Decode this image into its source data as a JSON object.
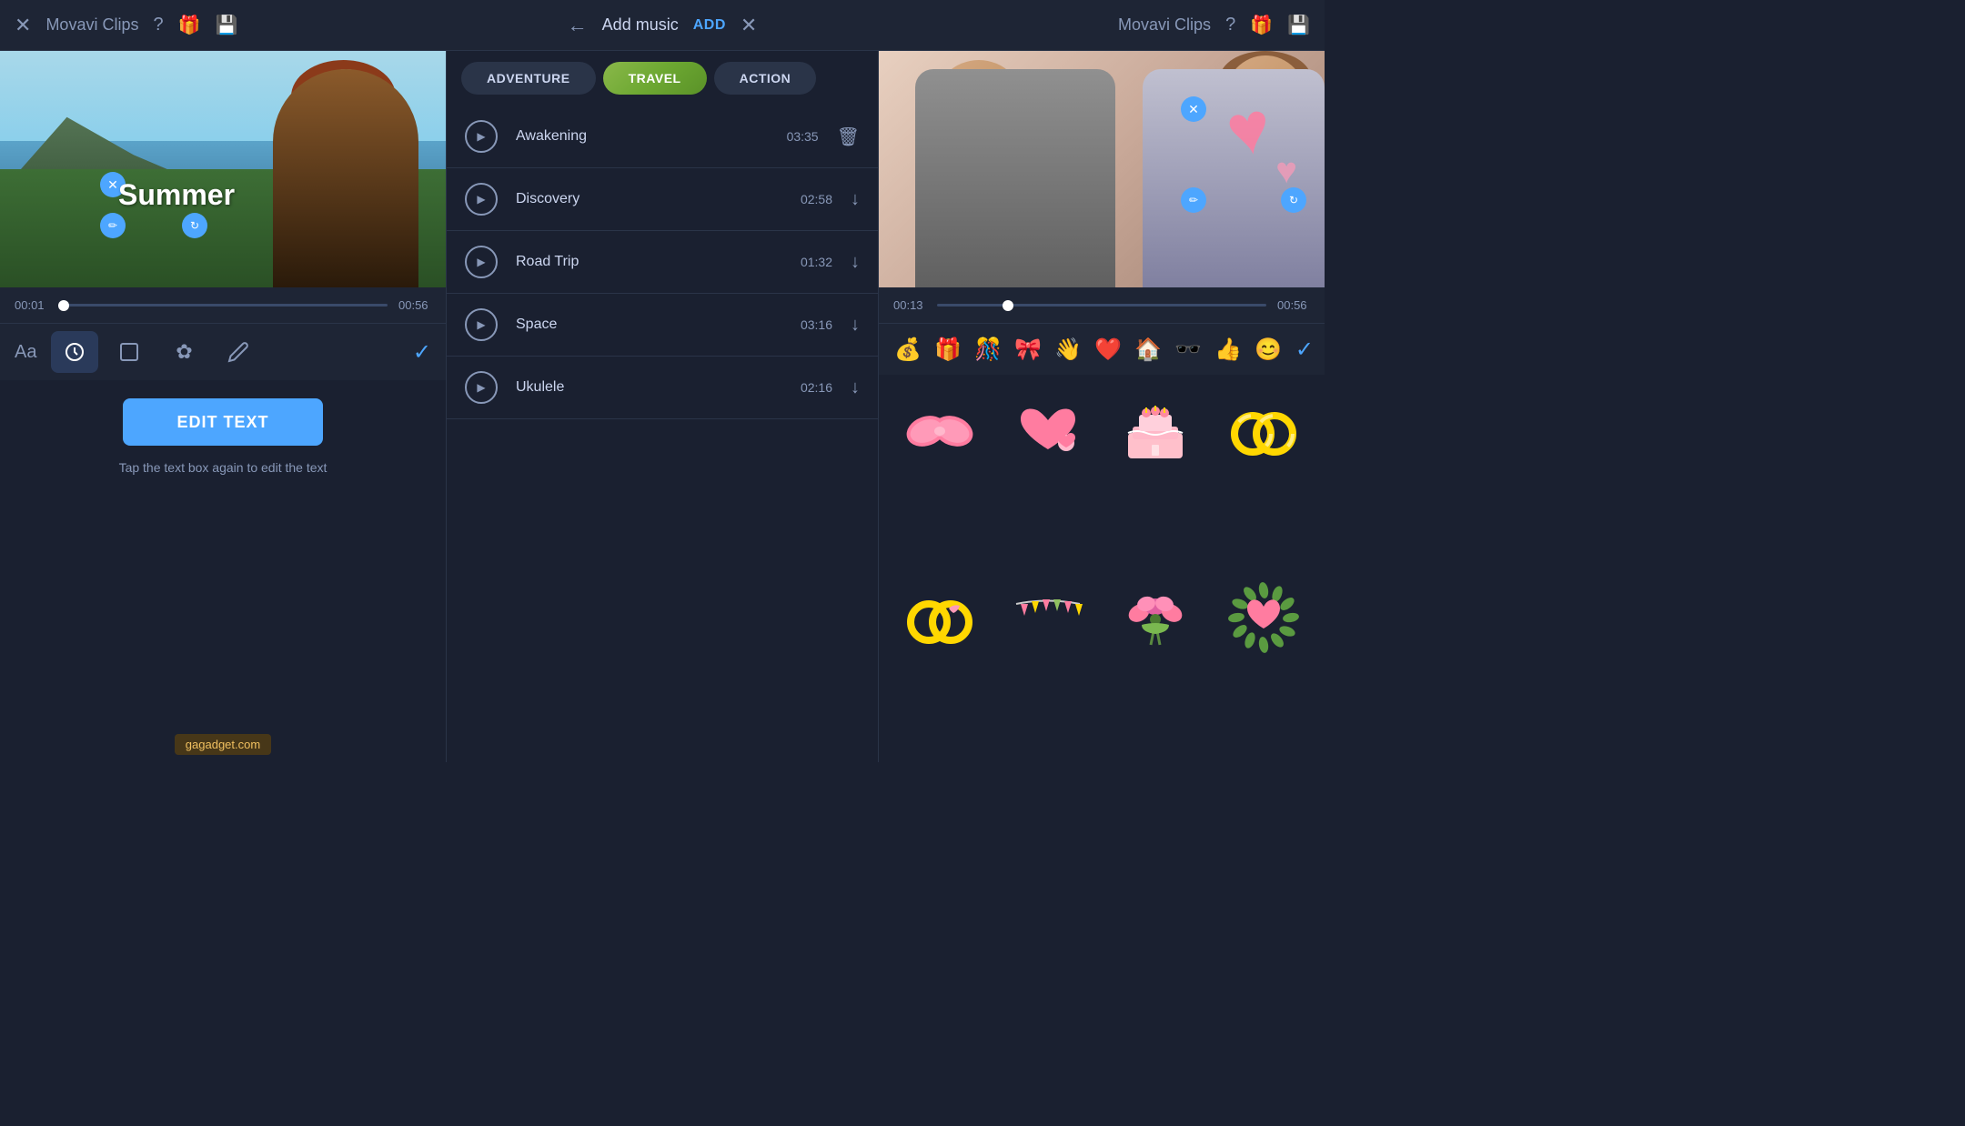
{
  "app": {
    "title": "Movavi Clips",
    "close_label": "×",
    "back_label": "←"
  },
  "header": {
    "left_title": "Movavi Clips",
    "center_title": "Add music",
    "add_label": "ADD",
    "close_label": "×",
    "right_title": "Movavi Clips"
  },
  "left_panel": {
    "text_overlay": "Summer",
    "timeline": {
      "start": "00:01",
      "end": "00:56"
    },
    "toolbar": {
      "aa_label": "Aa"
    },
    "edit_text_btn": "EDIT TEXT",
    "hint": "Tap the text box again to edit the text"
  },
  "music": {
    "tabs": [
      {
        "label": "ADVENTURE",
        "active": false
      },
      {
        "label": "TRAVEL",
        "active": true
      },
      {
        "label": "ACTION",
        "active": false
      }
    ],
    "tracks": [
      {
        "name": "Awakening",
        "duration": "03:35",
        "downloaded": true
      },
      {
        "name": "Discovery",
        "duration": "02:58",
        "downloaded": false
      },
      {
        "name": "Road Trip",
        "duration": "01:32",
        "downloaded": false
      },
      {
        "name": "Space",
        "duration": "03:16",
        "downloaded": false
      },
      {
        "name": "Ukulele",
        "duration": "02:16",
        "downloaded": false
      }
    ]
  },
  "right_panel": {
    "timeline": {
      "start": "00:13",
      "end": "00:56"
    },
    "emoji_bar": [
      "💰",
      "🎁",
      "🎊",
      "🎀",
      "🙋",
      "❤️",
      "🏠",
      "🕶️",
      "👍",
      "😊"
    ],
    "stickers": [
      {
        "type": "bow",
        "emoji": "🎀"
      },
      {
        "type": "hearts",
        "emoji": "💕"
      },
      {
        "type": "cake",
        "emoji": "🎂"
      },
      {
        "type": "rings",
        "emoji": "💍"
      },
      {
        "type": "rings2",
        "emoji": "💍"
      },
      {
        "type": "bunting",
        "emoji": "🎉"
      },
      {
        "type": "bouquet",
        "emoji": "💐"
      },
      {
        "type": "heart-wreath",
        "emoji": "💖"
      }
    ]
  },
  "watermark": {
    "text": "gagadget.com"
  },
  "icons": {
    "close": "✕",
    "back": "←",
    "play": "▶",
    "download": "↓",
    "trash": "🗑",
    "check": "✓",
    "edit_pencil": "✏",
    "resize": "↔",
    "clock": "○",
    "frame": "□",
    "flower": "✿",
    "pencil": "✏"
  }
}
